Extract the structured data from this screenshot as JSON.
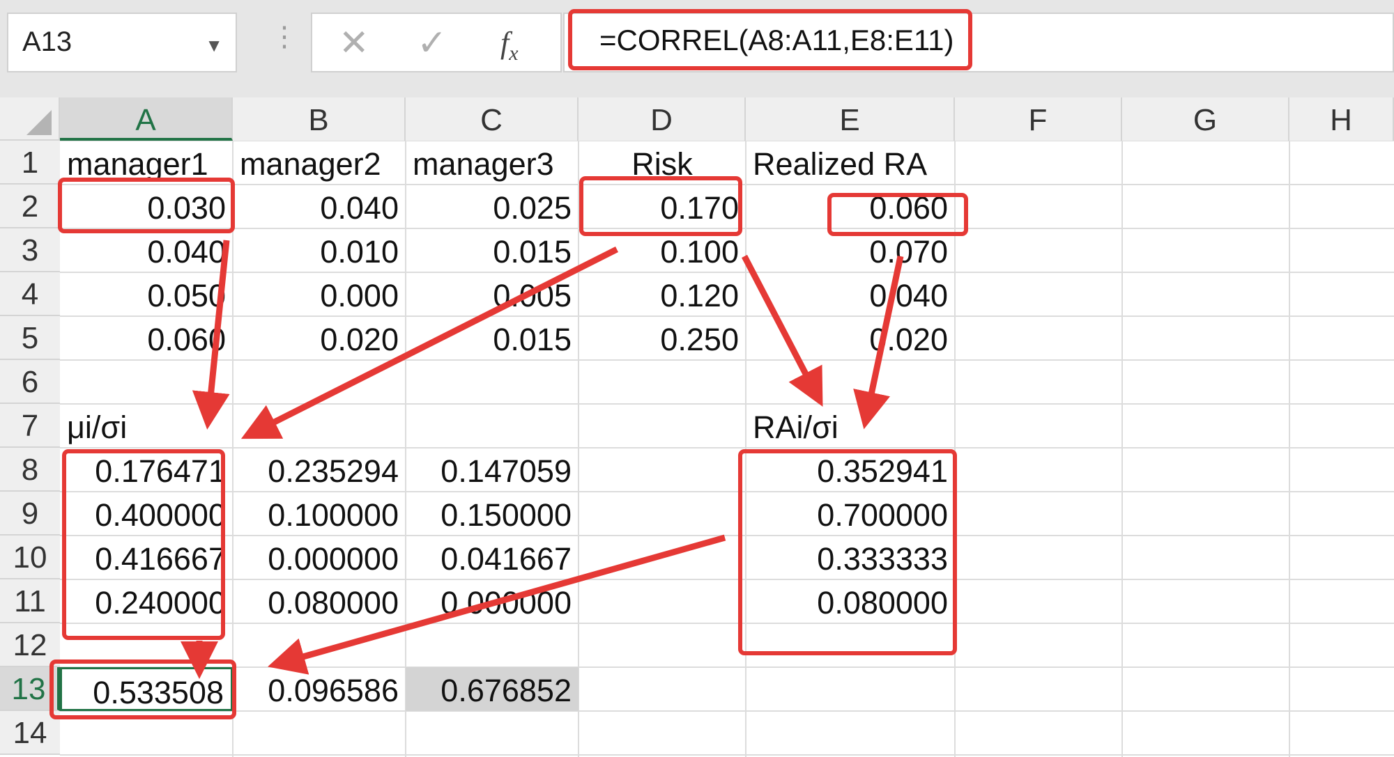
{
  "formula_bar": {
    "name_box": "A13",
    "name_box_dropdown_icon": "chevron-down-icon",
    "cancel_icon": "close-icon",
    "confirm_icon": "check-icon",
    "fx_label": "fx",
    "formula": "=CORREL(A8:A11,E8:E11)"
  },
  "columns": [
    "A",
    "B",
    "C",
    "D",
    "E",
    "F",
    "G",
    "H"
  ],
  "selected_column": "A",
  "selected_row": "13",
  "rows": [
    "1",
    "2",
    "3",
    "4",
    "5",
    "6",
    "7",
    "8",
    "9",
    "10",
    "11",
    "12",
    "13",
    "14"
  ],
  "cells": {
    "A1": "manager1",
    "B1": "manager2",
    "C1": "manager3",
    "D1": "Risk",
    "E1": "Realized RA",
    "A2": "0.030",
    "B2": "0.040",
    "C2": "0.025",
    "D2": "0.170",
    "E2": "0.060",
    "A3": "0.040",
    "B3": "0.010",
    "C3": "0.015",
    "D3": "0.100",
    "E3": "0.070",
    "A4": "0.050",
    "B4": "0.000",
    "C4": "0.005",
    "D4": "0.120",
    "E4": "0.040",
    "A5": "0.060",
    "B5": "0.020",
    "C5": "0.015",
    "D5": "0.250",
    "E5": "0.020",
    "A7": "μi/σi",
    "E7": "RAi/σi",
    "A8": "0.176471",
    "B8": "0.235294",
    "C8": "0.147059",
    "E8": "0.352941",
    "A9": "0.400000",
    "B9": "0.100000",
    "C9": "0.150000",
    "E9": "0.700000",
    "A10": "0.416667",
    "B10": "0.000000",
    "C10": "0.041667",
    "E10": "0.333333",
    "A11": "0.240000",
    "B11": "0.080000",
    "C11": "0.000000",
    "E11": "0.080000",
    "A13": "0.533508",
    "B13": "0.096586",
    "C13": "0.676852"
  },
  "annotation_color": "#e53935",
  "selection_color": "#217346"
}
